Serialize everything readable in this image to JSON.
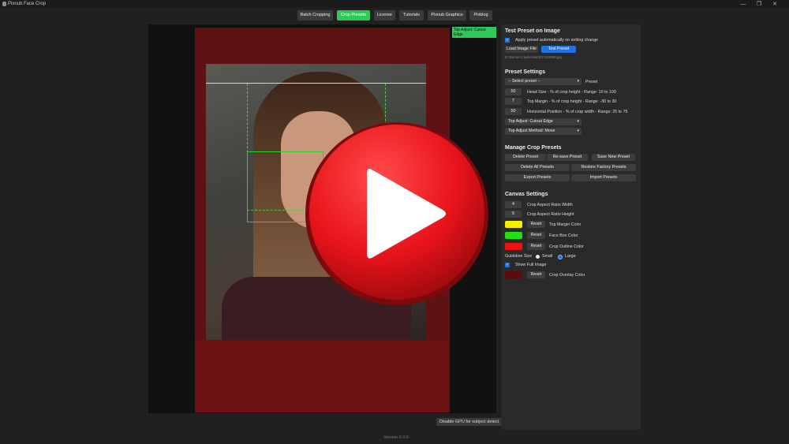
{
  "window": {
    "title": "Pixnub Face Crop",
    "controls": [
      "—",
      "❐",
      "✕"
    ]
  },
  "nav": [
    {
      "label": "Batch Cropping",
      "active": false
    },
    {
      "label": "Crop Presets",
      "active": true
    },
    {
      "label": "License",
      "active": false
    },
    {
      "label": "Tutorials",
      "active": false
    },
    {
      "label": "Pixnub Graphics",
      "active": false
    },
    {
      "label": "Pixblog",
      "active": false
    }
  ],
  "canvas": {
    "tag": "Top Adjust: Cutout Edge",
    "gpu_button": "Disable GPU for subject detect"
  },
  "version": "Version 6.0.6",
  "test": {
    "heading": "Test Preset on Image",
    "apply_auto": "Apply preset automatically on setting change",
    "load_btn": "Load Image File",
    "test_btn": "Test Preset",
    "path": "E:\\Senior-Clas\\class\\3\\F104590.jpg"
  },
  "settings": {
    "heading": "Preset Settings",
    "select_preset": "-- Select preset --",
    "preset_label": "Preset",
    "head_size": {
      "value": "50",
      "label": "Head Size - % of crop height - Range: 10 to 100"
    },
    "top_margin": {
      "value": "7",
      "label": "Top Margin - % of crop height - Range: -30 to 30"
    },
    "horiz_pos": {
      "value": "50",
      "label": "Horizontal Position - % of crop width - Range: 25 to 75"
    },
    "top_adjust": "Top Adjust: Cutout Edge",
    "top_adjust_method": "Top Adjust Method: Move"
  },
  "manage": {
    "heading": "Manage Crop Presets",
    "delete": "Delete Preset",
    "resave": "Re-save Preset",
    "save_new": "Save New Preset",
    "delete_all": "Delete All Presets",
    "restore": "Restore Factory Presets",
    "export": "Export Presets",
    "import": "Import Presets"
  },
  "canvas_settings": {
    "heading": "Canvas Settings",
    "aspect_w": {
      "value": "4",
      "label": "Crop Aspect Ratio Width"
    },
    "aspect_h": {
      "value": "5",
      "label": "Crop Aspect Ratio Height"
    },
    "reset": "Reset",
    "top_margin_color": {
      "label": "Top Margin Color",
      "color": "#f5ef00"
    },
    "face_box_color": {
      "label": "Face Box Color",
      "color": "#22e012"
    },
    "crop_outline_color": {
      "label": "Crop Outline Color",
      "color": "#ee1111"
    },
    "guideline_size": "Guideline Size",
    "small": "Small",
    "large": "Large",
    "show_full_image": "Show Full Image",
    "crop_overlay_color": {
      "label": "Crop Overlay Color",
      "color": "#5c0b0b"
    }
  },
  "colors": {
    "accent_green": "#2fc95b",
    "accent_blue": "#1e73e8",
    "play_red": "#e8131a"
  }
}
